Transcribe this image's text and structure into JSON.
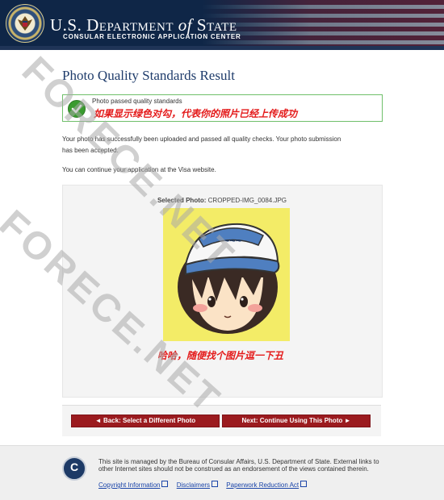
{
  "header": {
    "brand_us": "U.S. ",
    "brand_dept": "Department ",
    "brand_of": "of",
    "brand_state": " State",
    "subtitle": "CONSULAR ELECTRONIC APPLICATION CENTER"
  },
  "page": {
    "title": "Photo Quality Standards Result",
    "success_text": "Photo passed quality standards",
    "annotation_check": "如果显示绿色对勾，代表你的照片已经上传成功",
    "paragraph1": "Your photo has successfully been uploaded and passed all quality checks. Your photo submission has been accepted.",
    "paragraph2": "You can continue your application at the Visa website.",
    "selected_label": "Selected Photo:",
    "selected_file": " CROPPED-IMG_0084.JPG",
    "annotation_photo": "哈哈，随便找个图片逗一下丑"
  },
  "buttons": {
    "back": "◄ Back: Select a Different Photo",
    "next": "Next: Continue Using This Photo ►"
  },
  "footer": {
    "logo_letter": "C",
    "text": "This site is managed by the Bureau of Consular Affairs, U.S. Department of State. External links to other Internet sites should not be construed as an endorsement of the views contained therein.",
    "links": [
      "Copyright Information",
      "Disclaimers",
      "Paperwork Reduction Act"
    ]
  },
  "watermark": "FORECE.NET",
  "colors": {
    "navy": "#0f2647",
    "button": "#9b1b1f",
    "success_border": "#6fbf6a",
    "annotation": "#e41b1b",
    "photo_bg": "#f3ec67"
  }
}
